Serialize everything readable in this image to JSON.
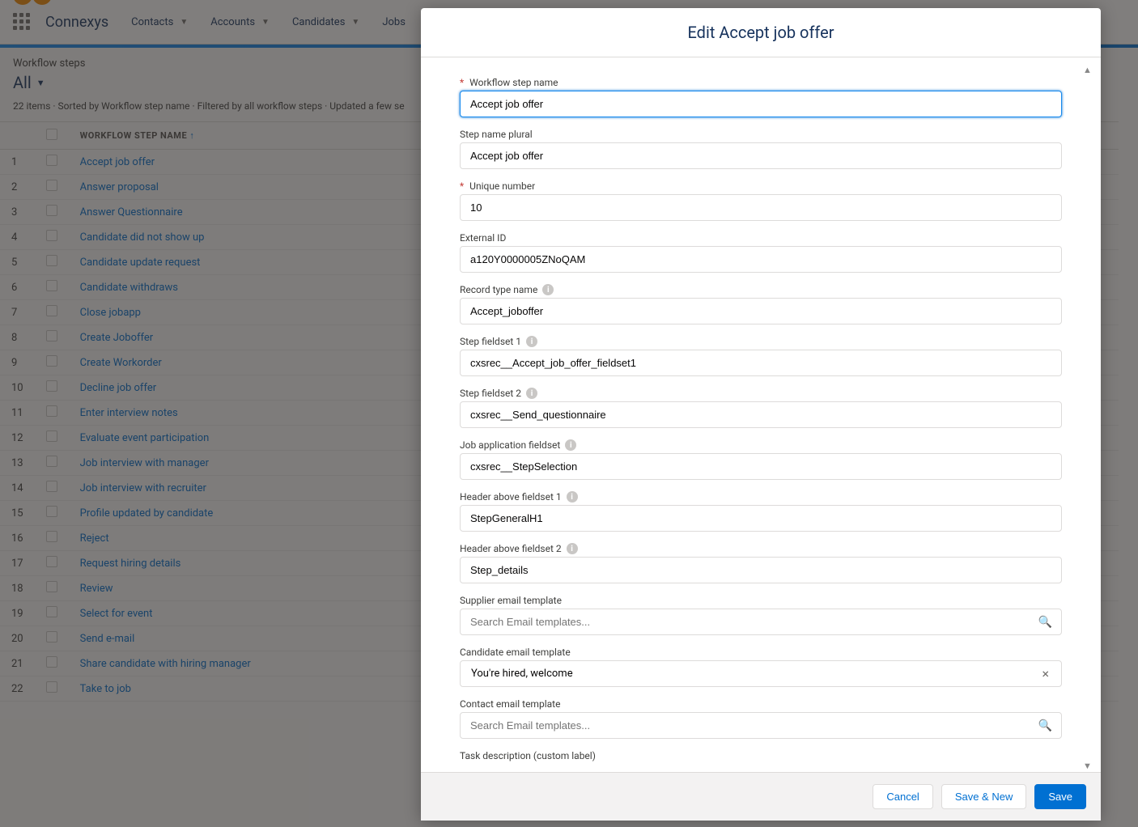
{
  "header": {
    "app_name": "Connexys",
    "nav": [
      "Contacts",
      "Accounts",
      "Candidates",
      "Jobs"
    ]
  },
  "list": {
    "label": "Workflow steps",
    "filter": "All",
    "meta": "22 items · Sorted by Workflow step name · Filtered by all workflow steps · Updated a few se",
    "column_header": "WORKFLOW STEP NAME",
    "rows": [
      "Accept job offer",
      "Answer proposal",
      "Answer Questionnaire",
      "Candidate did not show up",
      "Candidate update request",
      "Candidate withdraws",
      "Close jobapp",
      "Create Joboffer",
      "Create Workorder",
      "Decline job offer",
      "Enter interview notes",
      "Evaluate event participation",
      "Job interview with manager",
      "Job interview with recruiter",
      "Profile updated by candidate",
      "Reject",
      "Request hiring details",
      "Review",
      "Select for event",
      "Send e-mail",
      "Share candidate with hiring manager",
      "Take to job"
    ]
  },
  "modal": {
    "title": "Edit Accept job offer",
    "fields": {
      "step_name": {
        "label": "Workflow step name",
        "value": "Accept job offer",
        "required": true
      },
      "step_name_plural": {
        "label": "Step name plural",
        "value": "Accept job offer"
      },
      "unique_number": {
        "label": "Unique number",
        "value": "10",
        "required": true
      },
      "external_id": {
        "label": "External ID",
        "value": "a120Y0000005ZNoQAM"
      },
      "record_type": {
        "label": "Record type name",
        "value": "Accept_joboffer",
        "info": true
      },
      "fieldset1": {
        "label": "Step fieldset 1",
        "value": "cxsrec__Accept_job_offer_fieldset1",
        "info": true
      },
      "fieldset2": {
        "label": "Step fieldset 2",
        "value": "cxsrec__Send_questionnaire",
        "info": true
      },
      "job_app_fieldset": {
        "label": "Job application fieldset",
        "value": "cxsrec__StepSelection",
        "info": true
      },
      "header1": {
        "label": "Header above fieldset 1",
        "value": "StepGeneralH1",
        "info": true
      },
      "header2": {
        "label": "Header above fieldset 2",
        "value": "Step_details",
        "info": true
      },
      "supplier_email": {
        "label": "Supplier email template",
        "placeholder": "Search Email templates..."
      },
      "candidate_email": {
        "label": "Candidate email template",
        "value": "You're hired, welcome"
      },
      "contact_email": {
        "label": "Contact email template",
        "placeholder": "Search Email templates..."
      },
      "task_desc": {
        "label": "Task description (custom label)"
      }
    },
    "buttons": {
      "cancel": "Cancel",
      "save_new": "Save & New",
      "save": "Save"
    }
  }
}
